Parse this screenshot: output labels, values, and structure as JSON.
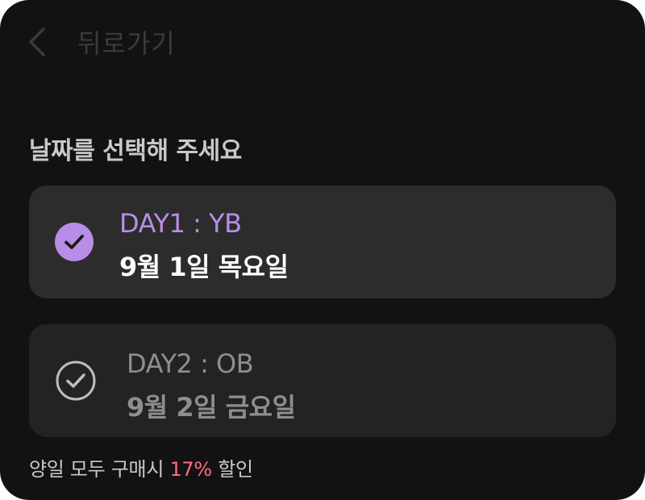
{
  "header": {
    "back_label": "뒤로가기",
    "back_icon": "chevron-left-icon"
  },
  "section": {
    "title": "날짜를 선택해 주세요"
  },
  "days": [
    {
      "title": "DAY1 : YB",
      "date": "9월 1일 목요일",
      "selected": true,
      "check_icon": "check-circle-filled-icon"
    },
    {
      "title": "DAY2 : OB",
      "date": "9월 2일 금요일",
      "selected": false,
      "check_icon": "check-circle-outline-icon"
    }
  ],
  "discount": {
    "prefix": "양일 모두 구매시 ",
    "percent": "17%",
    "suffix": " 할인"
  },
  "colors": {
    "background": "#121212",
    "selected_card": "#2c2c2c",
    "unselected_card": "#232323",
    "accent_purple": "#b88de8",
    "discount_red": "#ff6b7d"
  }
}
